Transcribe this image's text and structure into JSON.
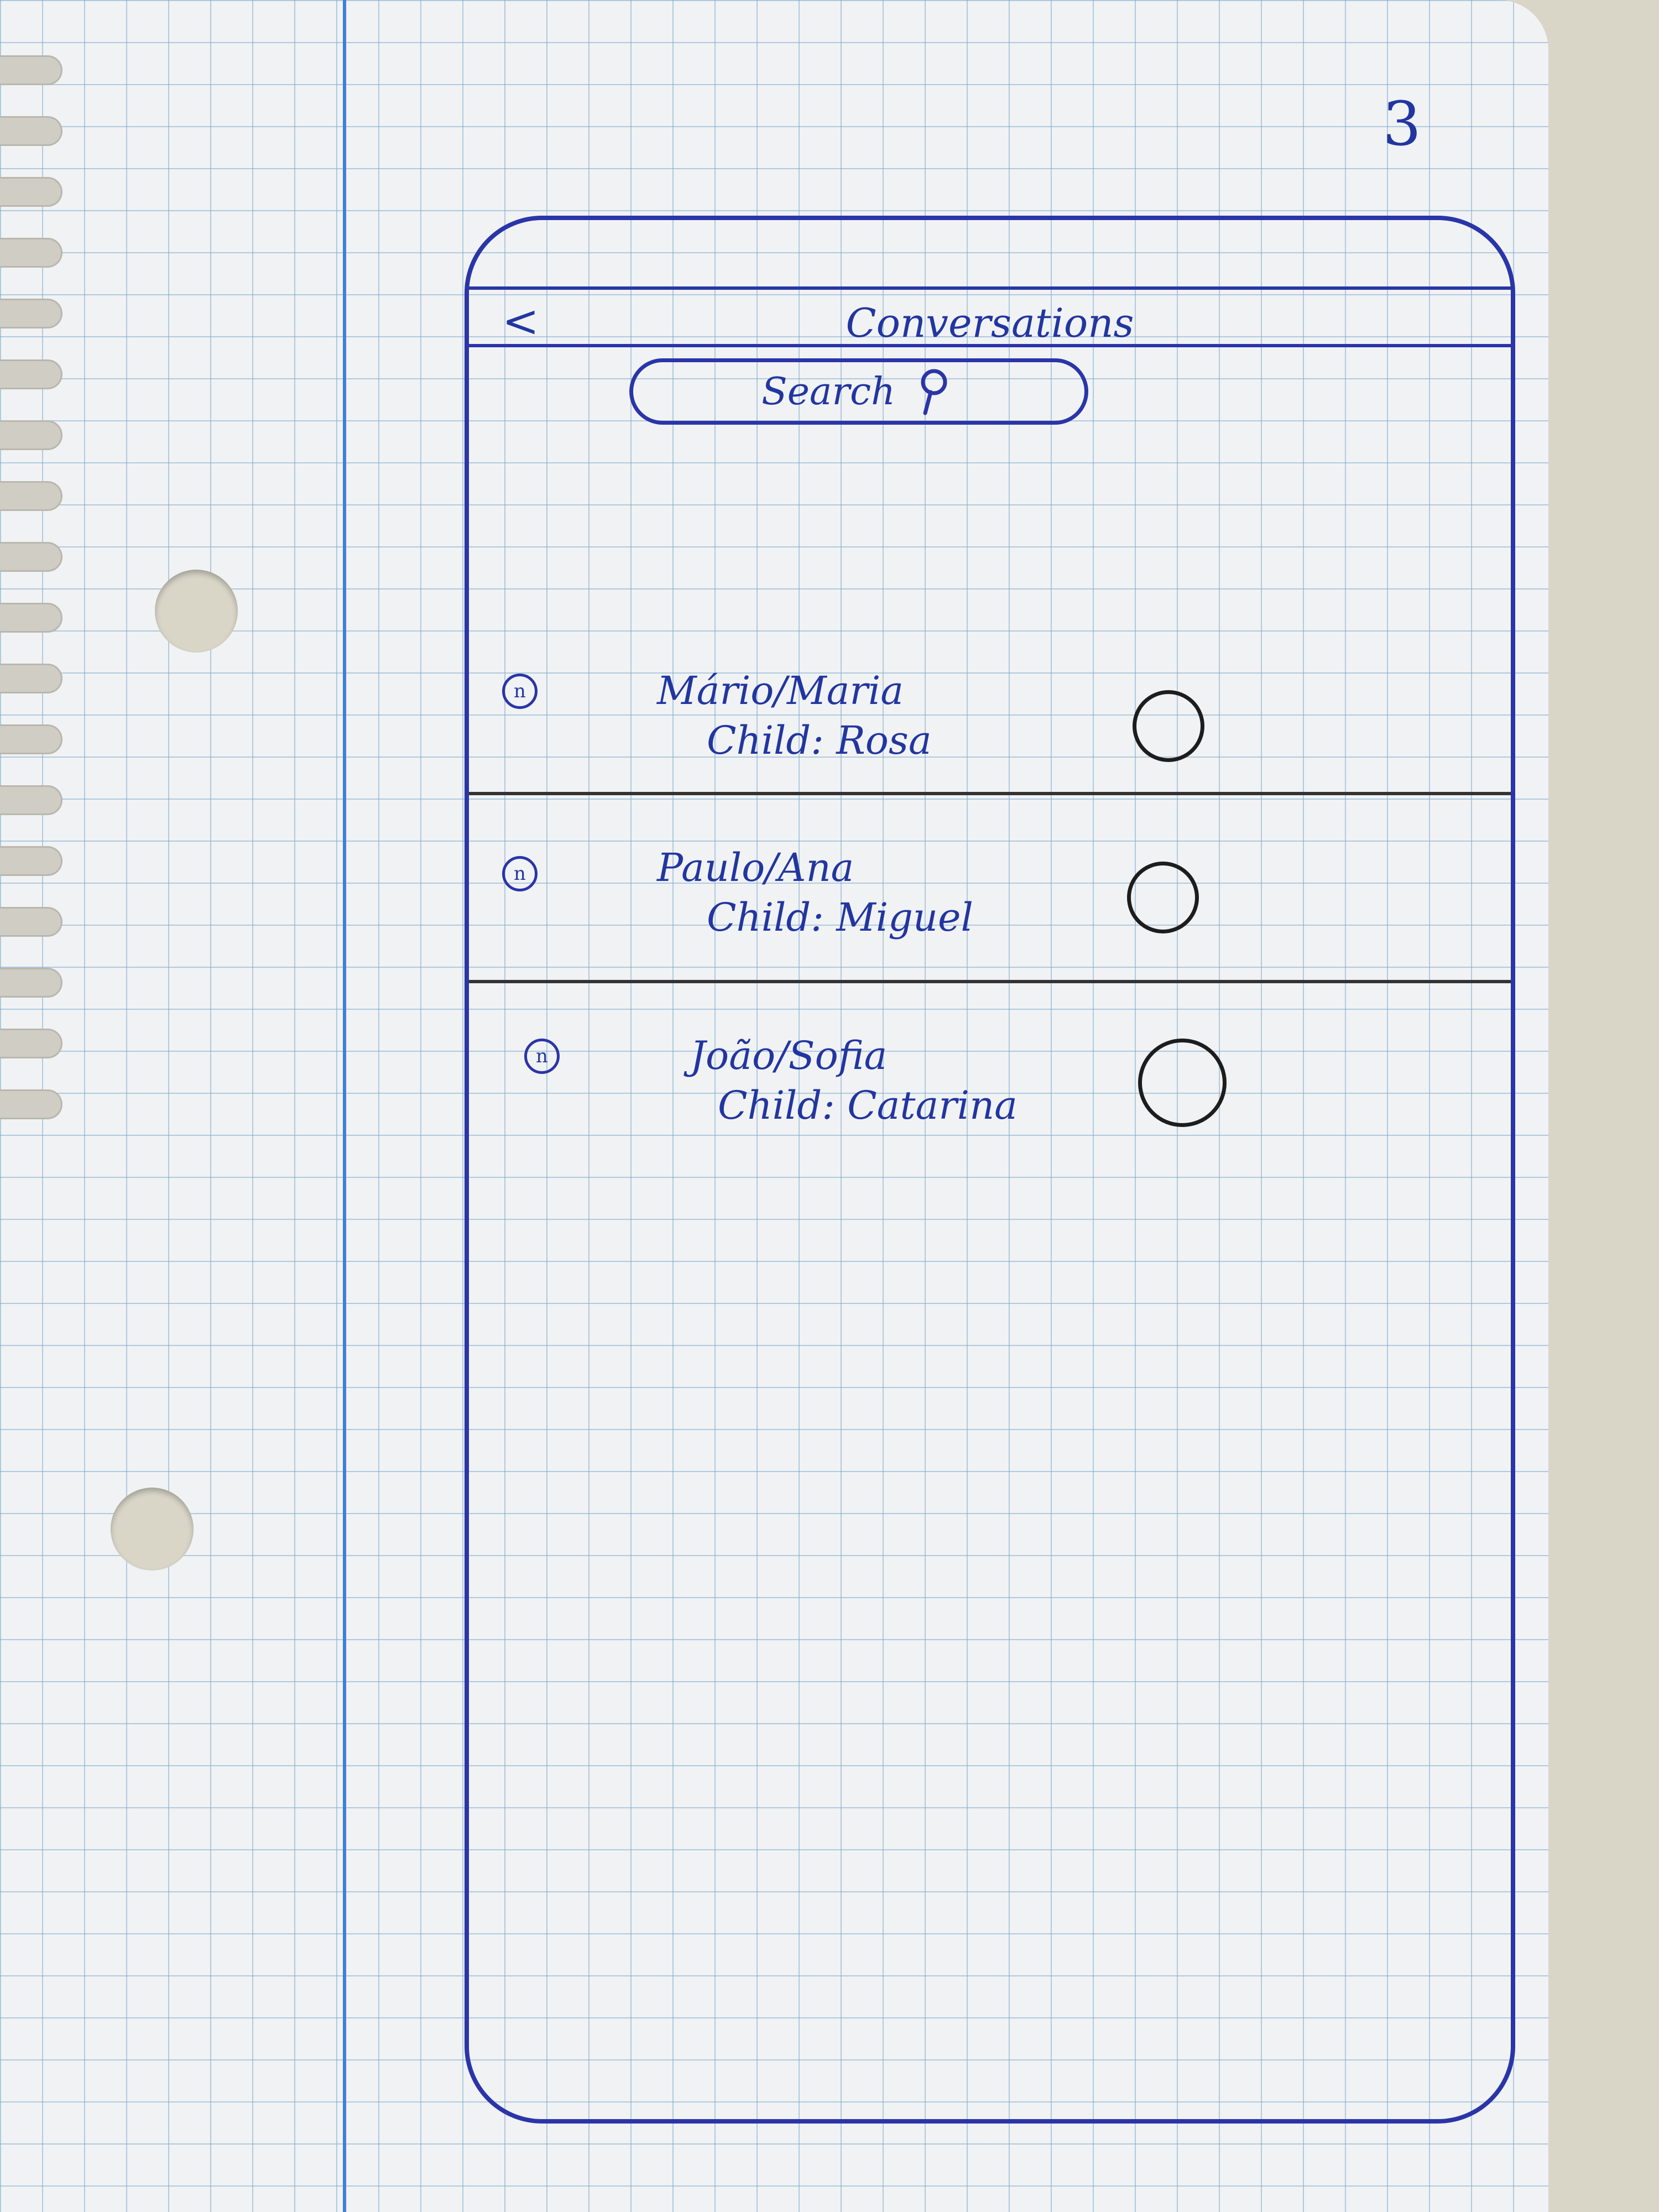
{
  "page_number": "3",
  "screen": {
    "back_label": "<",
    "title": "Conversations",
    "search_placeholder": "Search"
  },
  "conversations": [
    {
      "names": "Mário/Maria",
      "child": "Child: Rosa"
    },
    {
      "names": "Paulo/Ana",
      "child": "Child: Miguel"
    },
    {
      "names": "João/Sofia",
      "child": "Child: Catarina"
    }
  ],
  "colors": {
    "ink": "#2a35a8",
    "pencil": "#1d1d1d",
    "margin": "#3f7fd6"
  }
}
